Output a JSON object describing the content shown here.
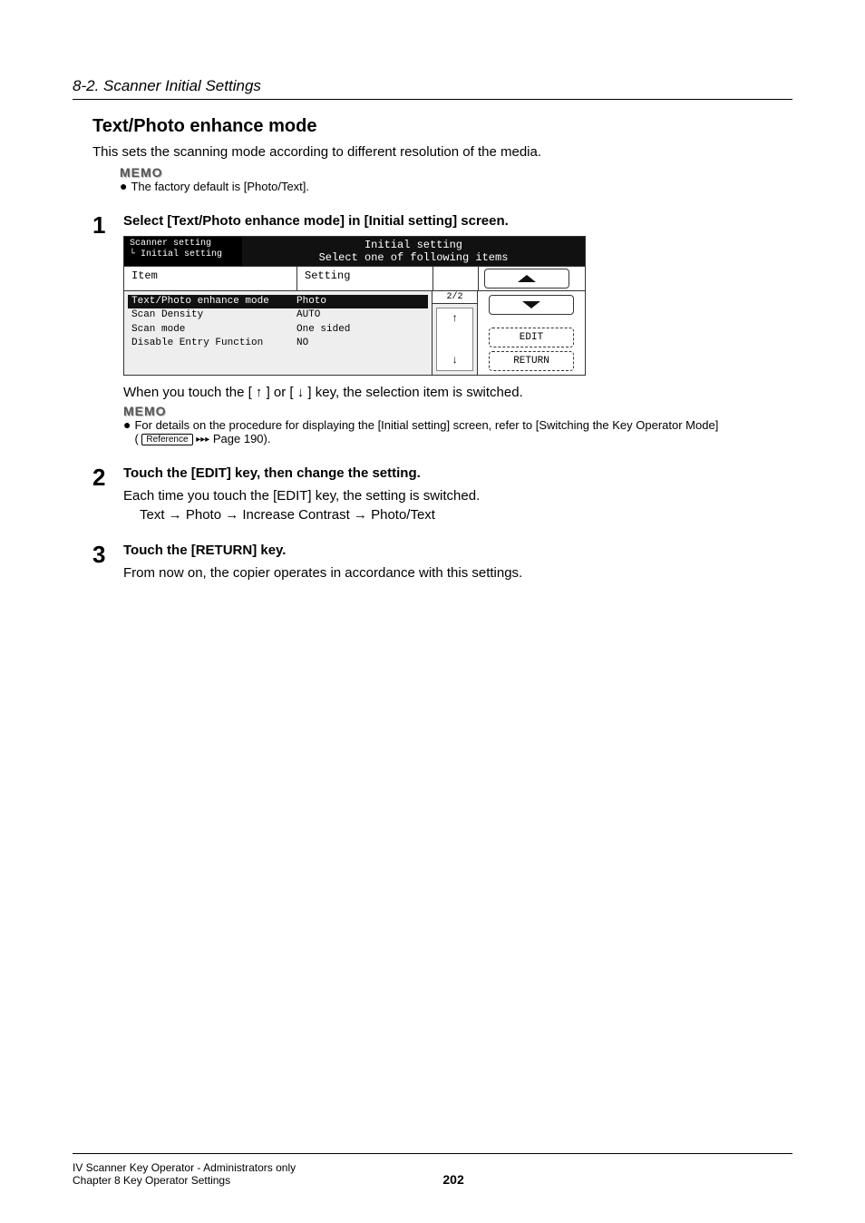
{
  "header": {
    "section": "8-2. Scanner Initial Settings"
  },
  "title": "Text/Photo enhance mode",
  "intro": "This sets the scanning mode according to different resolution of the media.",
  "memo1": {
    "label": "MEMO",
    "text": "The factory default is [Photo/Text]."
  },
  "steps": {
    "s1": {
      "num": "1",
      "heading": "Select [Text/Photo enhance mode] in [Initial setting] screen.",
      "after": "When you touch the [ ↑ ] or [ ↓ ] key, the selection item is switched."
    },
    "s2": {
      "num": "2",
      "heading": "Touch the [EDIT] key, then change the setting.",
      "line1": "Each time you touch the [EDIT] key, the setting is switched.",
      "line2": "Text → Photo → Increase Contrast → Photo/Text"
    },
    "s3": {
      "num": "3",
      "heading": "Touch the [RETURN] key.",
      "line1": "From now on, the copier operates in accordance with this settings."
    }
  },
  "memo2": {
    "label": "MEMO",
    "text_a": "For details on the procedure for displaying the [Initial setting] screen, refer to [Switching the Key Operator Mode]",
    "ref_label": "Reference",
    "text_b": "Page 190)."
  },
  "screenshot": {
    "breadcrumb_top": "Scanner setting",
    "breadcrumb_sub": "└ Initial setting",
    "panel_title": "Initial setting",
    "panel_sub": "Select one of following items",
    "col_item": "Item",
    "col_setting": "Setting",
    "rows": [
      {
        "item": "Text/Photo enhance mode",
        "setting": "Photo"
      },
      {
        "item": "Scan Density",
        "setting": "AUTO"
      },
      {
        "item": "Scan mode",
        "setting": "One sided"
      },
      {
        "item": "Disable Entry Function",
        "setting": "NO"
      }
    ],
    "page_indicator": "2/2",
    "arrow_up": "↑",
    "arrow_down": "↓",
    "btn_edit": "EDIT",
    "btn_return": "RETURN"
  },
  "footer": {
    "left1": "IV Scanner Key Operator - Administrators only",
    "left2": "Chapter 8 Key Operator Settings",
    "page": "202"
  }
}
